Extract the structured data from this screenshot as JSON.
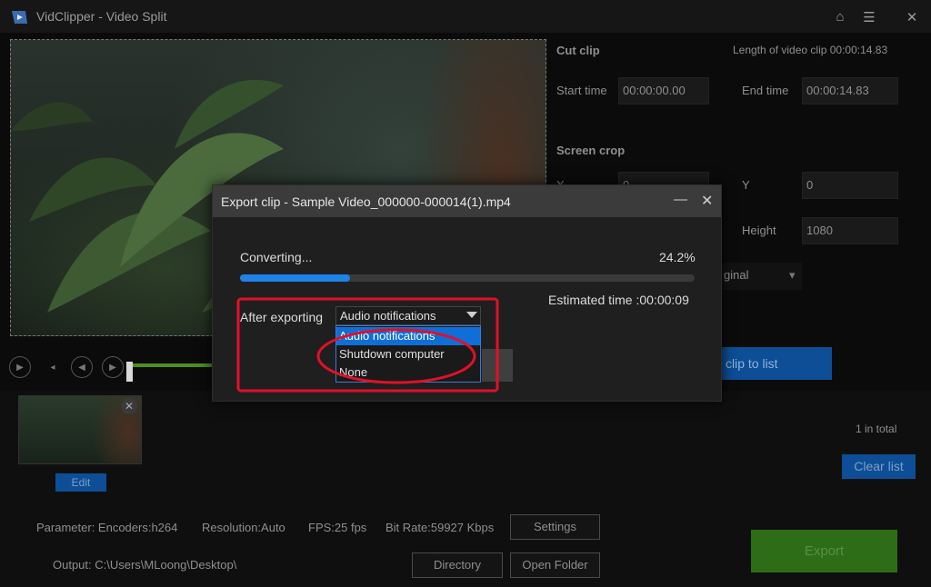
{
  "app": {
    "title": "VidClipper - Video Split"
  },
  "window_controls": {
    "home_icon": "home-icon",
    "menu_icon": "menu-icon",
    "close_icon": "close-icon"
  },
  "player": {
    "controls": [
      "play-icon",
      "prev-icon",
      "rewind-icon",
      "forward-icon"
    ]
  },
  "right_panel": {
    "cut_clip_heading": "Cut clip",
    "length_text": "Length of video clip 00:00:14.83",
    "start_label": "Start time",
    "start_value": "00:00:00.00",
    "end_label": "End time",
    "end_value": "00:00:14.83",
    "crop_heading": "Screen crop",
    "x_label": "X",
    "x_value": "0",
    "y_label": "Y",
    "y_value": "0",
    "height_label": "Height",
    "height_value": "1080",
    "ratio_partial": "ginal",
    "add_button_partial": "clip to list"
  },
  "clip_list": {
    "edit_label": "Edit",
    "count_text": "1 in total",
    "clear_label": "Clear list"
  },
  "bottom": {
    "parameter": "Parameter:  Encoders:h264",
    "resolution": "Resolution:Auto",
    "fps": "FPS:25 fps",
    "bitrate": "Bit Rate:59927 Kbps",
    "settings_label": "Settings",
    "output": "Output:   C:\\Users\\MLoong\\Desktop\\",
    "directory_label": "Directory",
    "open_folder_label": "Open Folder",
    "export_label": "Export"
  },
  "dialog": {
    "title": "Export clip - Sample Video_000000-000014(1).mp4",
    "min_glyph": "—",
    "close_glyph": "✕",
    "converting_label": "Converting...",
    "progress_text": "24.2%",
    "progress": 0.242,
    "estimated": "Estimated time :00:00:09",
    "after_label": "After exporting",
    "select_value": "Audio notifications",
    "options": [
      "Audio notifications",
      "Shutdown computer",
      "None"
    ],
    "selected_index": 0,
    "partial_button": "l"
  },
  "colors": {
    "accent_blue": "#1f82e6",
    "annotation_red": "#e0102a",
    "export_green": "#2d6d17"
  }
}
